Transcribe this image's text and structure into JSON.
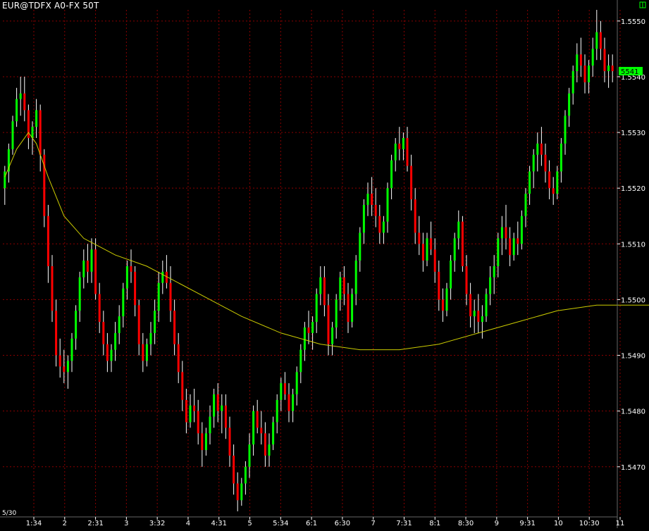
{
  "window": {
    "title": "EUR@TDFX A0-FX 50T",
    "date_label": "5/30"
  },
  "colors": {
    "background": "#000000",
    "grid": "#8b0000",
    "up": "#00ff00",
    "down": "#ff0000",
    "wick": "#ffffff",
    "moving_average": "#cccc00",
    "axis_text": "#ffffff",
    "last_price_bg": "#00ff00"
  },
  "chart_data": {
    "type": "candlestick",
    "title": "EUR@TDFX A0-FX 50T",
    "y_ticks": [
      "1.5550",
      "1.5540",
      "1.5530",
      "1.5520",
      "1.5510",
      "1.5500",
      "1.5490",
      "1.5480",
      "1.5470"
    ],
    "y_range": [
      1.5461,
      1.5552
    ],
    "last_price_label": "5541",
    "x_ticks": [
      "1:34",
      "2",
      "2:31",
      "3",
      "3:32",
      "4",
      "4:31",
      "5",
      "5:34",
      "6:1",
      "6:30",
      "7",
      "7:31",
      "8:1",
      "8:30",
      "9",
      "9:31",
      "10",
      "10:30",
      "11"
    ],
    "gridlines": true,
    "moving_average": [
      [
        0,
        1.5522
      ],
      [
        3,
        1.5527
      ],
      [
        6,
        1.553
      ],
      [
        8,
        1.5528
      ],
      [
        11,
        1.5522
      ],
      [
        15,
        1.5515
      ],
      [
        20,
        1.5511
      ],
      [
        28,
        1.5508
      ],
      [
        36,
        1.5506
      ],
      [
        44,
        1.5503
      ],
      [
        52,
        1.55
      ],
      [
        60,
        1.5497
      ],
      [
        70,
        1.5494
      ],
      [
        80,
        1.5492
      ],
      [
        90,
        1.5491
      ],
      [
        100,
        1.5491
      ],
      [
        110,
        1.5492
      ],
      [
        120,
        1.5494
      ],
      [
        130,
        1.5496
      ],
      [
        140,
        1.5498
      ],
      [
        150,
        1.5499
      ],
      [
        160,
        1.5499
      ],
      [
        170,
        1.5499
      ],
      [
        180,
        1.55
      ],
      [
        190,
        1.5501
      ],
      [
        200,
        1.5502
      ],
      [
        210,
        1.5504
      ],
      [
        218,
        1.5506
      ]
    ],
    "candles": [
      [
        1.552,
        1.5524,
        1.5517,
        1.5523
      ],
      [
        1.5523,
        1.5528,
        1.5521,
        1.5527
      ],
      [
        1.5527,
        1.5533,
        1.5526,
        1.5532
      ],
      [
        1.5532,
        1.5538,
        1.5531,
        1.5536
      ],
      [
        1.5536,
        1.554,
        1.5533,
        1.5537
      ],
      [
        1.5537,
        1.554,
        1.5532,
        1.5534
      ],
      [
        1.5534,
        1.5535,
        1.5527,
        1.5529
      ],
      [
        1.5529,
        1.5532,
        1.5526,
        1.5531
      ],
      [
        1.5531,
        1.5536,
        1.5529,
        1.5534
      ],
      [
        1.5534,
        1.5535,
        1.5523,
        1.5526
      ],
      [
        1.5526,
        1.5527,
        1.5513,
        1.5515
      ],
      [
        1.5515,
        1.5517,
        1.5503,
        1.5506
      ],
      [
        1.5506,
        1.5508,
        1.5496,
        1.5498
      ],
      [
        1.5498,
        1.55,
        1.5488,
        1.549
      ],
      [
        1.549,
        1.5493,
        1.5486,
        1.5488
      ],
      [
        1.5488,
        1.5491,
        1.5485,
        1.5487
      ],
      [
        1.5487,
        1.549,
        1.5484,
        1.5489
      ],
      [
        1.5489,
        1.5494,
        1.5487,
        1.5493
      ],
      [
        1.5493,
        1.5499,
        1.5491,
        1.5498
      ],
      [
        1.5498,
        1.5505,
        1.5496,
        1.5504
      ],
      [
        1.5504,
        1.5509,
        1.5502,
        1.5507
      ],
      [
        1.5507,
        1.551,
        1.5503,
        1.5505
      ],
      [
        1.5505,
        1.5511,
        1.5503,
        1.5509
      ],
      [
        1.5509,
        1.5511,
        1.55,
        1.5501
      ],
      [
        1.5501,
        1.5503,
        1.5494,
        1.5496
      ],
      [
        1.5496,
        1.5498,
        1.549,
        1.5492
      ],
      [
        1.5492,
        1.5494,
        1.5487,
        1.5489
      ],
      [
        1.5489,
        1.5492,
        1.5487,
        1.5491
      ],
      [
        1.5491,
        1.5496,
        1.5489,
        1.5494
      ],
      [
        1.5494,
        1.5499,
        1.5492,
        1.5497
      ],
      [
        1.5497,
        1.5503,
        1.5495,
        1.5502
      ],
      [
        1.5502,
        1.5507,
        1.55,
        1.5506
      ],
      [
        1.5506,
        1.5509,
        1.5503,
        1.5505
      ],
      [
        1.5505,
        1.5506,
        1.5497,
        1.5499
      ],
      [
        1.5499,
        1.55,
        1.549,
        1.5492
      ],
      [
        1.5492,
        1.5494,
        1.5487,
        1.5489
      ],
      [
        1.5489,
        1.5493,
        1.5488,
        1.5492
      ],
      [
        1.5492,
        1.5496,
        1.549,
        1.5494
      ],
      [
        1.5494,
        1.55,
        1.5492,
        1.5498
      ],
      [
        1.5498,
        1.5505,
        1.5496,
        1.5503
      ],
      [
        1.5503,
        1.5507,
        1.5501,
        1.5505
      ],
      [
        1.5505,
        1.5508,
        1.5502,
        1.5503
      ],
      [
        1.5503,
        1.5506,
        1.5496,
        1.5498
      ],
      [
        1.5498,
        1.55,
        1.549,
        1.5492
      ],
      [
        1.5492,
        1.5494,
        1.5485,
        1.5487
      ],
      [
        1.5487,
        1.5489,
        1.548,
        1.5482
      ],
      [
        1.5482,
        1.5484,
        1.5476,
        1.5478
      ],
      [
        1.5478,
        1.5483,
        1.5477,
        1.5481
      ],
      [
        1.5481,
        1.5484,
        1.5478,
        1.548
      ],
      [
        1.548,
        1.5482,
        1.5474,
        1.5476
      ],
      [
        1.5476,
        1.5478,
        1.547,
        1.5473
      ],
      [
        1.5473,
        1.5477,
        1.5472,
        1.5476
      ],
      [
        1.5476,
        1.5481,
        1.5474,
        1.5479
      ],
      [
        1.5479,
        1.5484,
        1.5477,
        1.5483
      ],
      [
        1.5483,
        1.5485,
        1.5478,
        1.548
      ],
      [
        1.548,
        1.5483,
        1.5476,
        1.5481
      ],
      [
        1.5481,
        1.5483,
        1.5475,
        1.5477
      ],
      [
        1.5477,
        1.5479,
        1.547,
        1.5472
      ],
      [
        1.5472,
        1.5474,
        1.5465,
        1.5467
      ],
      [
        1.5467,
        1.5469,
        1.5462,
        1.5464
      ],
      [
        1.5464,
        1.5468,
        1.5463,
        1.5467
      ],
      [
        1.5467,
        1.5471,
        1.5465,
        1.547
      ],
      [
        1.547,
        1.5476,
        1.5468,
        1.5474
      ],
      [
        1.5474,
        1.5481,
        1.5472,
        1.548
      ],
      [
        1.548,
        1.5482,
        1.5476,
        1.5477
      ],
      [
        1.5477,
        1.548,
        1.5474,
        1.5476
      ],
      [
        1.5476,
        1.5478,
        1.547,
        1.5472
      ],
      [
        1.5472,
        1.5476,
        1.547,
        1.5474
      ],
      [
        1.5474,
        1.5479,
        1.5473,
        1.5478
      ],
      [
        1.5478,
        1.5483,
        1.5476,
        1.5482
      ],
      [
        1.5482,
        1.5486,
        1.548,
        1.5485
      ],
      [
        1.5485,
        1.5487,
        1.5482,
        1.5483
      ],
      [
        1.5483,
        1.5485,
        1.5478,
        1.548
      ],
      [
        1.548,
        1.5484,
        1.5478,
        1.5483
      ],
      [
        1.5483,
        1.5488,
        1.5481,
        1.5487
      ],
      [
        1.5487,
        1.5492,
        1.5485,
        1.5491
      ],
      [
        1.5491,
        1.5496,
        1.5489,
        1.5495
      ],
      [
        1.5495,
        1.5498,
        1.5492,
        1.5494
      ],
      [
        1.5494,
        1.5497,
        1.5491,
        1.5496
      ],
      [
        1.5496,
        1.5502,
        1.5494,
        1.5501
      ],
      [
        1.5501,
        1.5506,
        1.5499,
        1.5504
      ],
      [
        1.5504,
        1.5506,
        1.5497,
        1.5499
      ],
      [
        1.5499,
        1.5501,
        1.549,
        1.5492
      ],
      [
        1.5492,
        1.5496,
        1.549,
        1.5495
      ],
      [
        1.5495,
        1.5501,
        1.5493,
        1.55
      ],
      [
        1.55,
        1.5505,
        1.5498,
        1.5504
      ],
      [
        1.5504,
        1.5506,
        1.5499,
        1.5501
      ],
      [
        1.5501,
        1.5503,
        1.5494,
        1.5496
      ],
      [
        1.5496,
        1.5502,
        1.5495,
        1.5501
      ],
      [
        1.5501,
        1.5508,
        1.5499,
        1.5507
      ],
      [
        1.5507,
        1.5513,
        1.5505,
        1.5512
      ],
      [
        1.5512,
        1.5518,
        1.551,
        1.5517
      ],
      [
        1.5517,
        1.5521,
        1.5515,
        1.5519
      ],
      [
        1.5519,
        1.5522,
        1.5515,
        1.5517
      ],
      [
        1.5517,
        1.552,
        1.5513,
        1.5515
      ],
      [
        1.5515,
        1.5517,
        1.551,
        1.5512
      ],
      [
        1.5512,
        1.5515,
        1.551,
        1.5514
      ],
      [
        1.5514,
        1.5521,
        1.5512,
        1.552
      ],
      [
        1.552,
        1.5526,
        1.5518,
        1.5525
      ],
      [
        1.5525,
        1.5529,
        1.5523,
        1.5528
      ],
      [
        1.5528,
        1.5531,
        1.5525,
        1.5527
      ],
      [
        1.5527,
        1.553,
        1.5525,
        1.5529
      ],
      [
        1.5529,
        1.5531,
        1.5523,
        1.5524
      ],
      [
        1.5524,
        1.5526,
        1.5516,
        1.5518
      ],
      [
        1.5518,
        1.552,
        1.551,
        1.5512
      ],
      [
        1.5512,
        1.5515,
        1.5508,
        1.551
      ],
      [
        1.551,
        1.5512,
        1.5505,
        1.5507
      ],
      [
        1.5507,
        1.5512,
        1.5506,
        1.5511
      ],
      [
        1.5511,
        1.5514,
        1.5508,
        1.5509
      ],
      [
        1.5509,
        1.5511,
        1.5503,
        1.5505
      ],
      [
        1.5505,
        1.5507,
        1.5498,
        1.55
      ],
      [
        1.55,
        1.5502,
        1.5496,
        1.5498
      ],
      [
        1.5498,
        1.5503,
        1.5497,
        1.5502
      ],
      [
        1.5502,
        1.5508,
        1.55,
        1.5507
      ],
      [
        1.5507,
        1.5512,
        1.5505,
        1.5511
      ],
      [
        1.5511,
        1.5516,
        1.5509,
        1.5514
      ],
      [
        1.5514,
        1.5515,
        1.5505,
        1.5506
      ],
      [
        1.5506,
        1.5508,
        1.5499,
        1.5501
      ],
      [
        1.5501,
        1.5503,
        1.5495,
        1.5497
      ],
      [
        1.5497,
        1.55,
        1.5494,
        1.5498
      ],
      [
        1.5498,
        1.5501,
        1.5494,
        1.5496
      ],
      [
        1.5496,
        1.5499,
        1.5493,
        1.5497
      ],
      [
        1.5497,
        1.5502,
        1.5496,
        1.5501
      ],
      [
        1.5501,
        1.5506,
        1.5499,
        1.5504
      ],
      [
        1.5504,
        1.5508,
        1.5501,
        1.5506
      ],
      [
        1.5506,
        1.5512,
        1.5504,
        1.5511
      ],
      [
        1.5511,
        1.5515,
        1.5508,
        1.5513
      ],
      [
        1.5513,
        1.5517,
        1.5509,
        1.5511
      ],
      [
        1.5511,
        1.5513,
        1.5506,
        1.5508
      ],
      [
        1.5508,
        1.5512,
        1.5507,
        1.5511
      ],
      [
        1.5511,
        1.5514,
        1.5508,
        1.551
      ],
      [
        1.551,
        1.5516,
        1.5509,
        1.5515
      ],
      [
        1.5515,
        1.552,
        1.5513,
        1.5519
      ],
      [
        1.5519,
        1.5524,
        1.5517,
        1.5523
      ],
      [
        1.5523,
        1.5527,
        1.552,
        1.5526
      ],
      [
        1.5526,
        1.553,
        1.5523,
        1.5528
      ],
      [
        1.5528,
        1.5531,
        1.5524,
        1.5526
      ],
      [
        1.5526,
        1.5528,
        1.5521,
        1.5523
      ],
      [
        1.5523,
        1.5525,
        1.5518,
        1.552
      ],
      [
        1.552,
        1.5522,
        1.5517,
        1.5519
      ],
      [
        1.5519,
        1.5524,
        1.5518,
        1.5523
      ],
      [
        1.5523,
        1.5529,
        1.5521,
        1.5528
      ],
      [
        1.5528,
        1.5534,
        1.5526,
        1.5533
      ],
      [
        1.5533,
        1.5538,
        1.5531,
        1.5537
      ],
      [
        1.5537,
        1.5542,
        1.5535,
        1.5541
      ],
      [
        1.5541,
        1.5546,
        1.5539,
        1.5544
      ],
      [
        1.5544,
        1.5547,
        1.554,
        1.5542
      ],
      [
        1.5542,
        1.5544,
        1.5537,
        1.5539
      ],
      [
        1.5539,
        1.5543,
        1.5537,
        1.5542
      ],
      [
        1.5542,
        1.5547,
        1.554,
        1.5545
      ],
      [
        1.5545,
        1.5552,
        1.5543,
        1.5548
      ],
      [
        1.5548,
        1.555,
        1.5543,
        1.5545
      ],
      [
        1.5545,
        1.5547,
        1.5539,
        1.5541
      ],
      [
        1.5541,
        1.5544,
        1.5538,
        1.5542
      ],
      [
        1.5542,
        1.5544,
        1.5539,
        1.5541
      ]
    ]
  }
}
